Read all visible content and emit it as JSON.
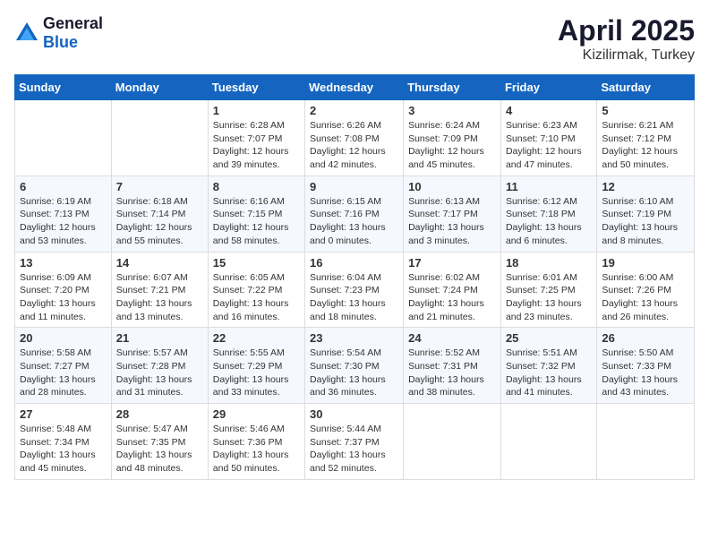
{
  "header": {
    "logo_general": "General",
    "logo_blue": "Blue",
    "month_title": "April 2025",
    "location": "Kizilirmak, Turkey"
  },
  "weekdays": [
    "Sunday",
    "Monday",
    "Tuesday",
    "Wednesday",
    "Thursday",
    "Friday",
    "Saturday"
  ],
  "weeks": [
    [
      {
        "day": "",
        "detail": ""
      },
      {
        "day": "",
        "detail": ""
      },
      {
        "day": "1",
        "detail": "Sunrise: 6:28 AM\nSunset: 7:07 PM\nDaylight: 12 hours and 39 minutes."
      },
      {
        "day": "2",
        "detail": "Sunrise: 6:26 AM\nSunset: 7:08 PM\nDaylight: 12 hours and 42 minutes."
      },
      {
        "day": "3",
        "detail": "Sunrise: 6:24 AM\nSunset: 7:09 PM\nDaylight: 12 hours and 45 minutes."
      },
      {
        "day": "4",
        "detail": "Sunrise: 6:23 AM\nSunset: 7:10 PM\nDaylight: 12 hours and 47 minutes."
      },
      {
        "day": "5",
        "detail": "Sunrise: 6:21 AM\nSunset: 7:12 PM\nDaylight: 12 hours and 50 minutes."
      }
    ],
    [
      {
        "day": "6",
        "detail": "Sunrise: 6:19 AM\nSunset: 7:13 PM\nDaylight: 12 hours and 53 minutes."
      },
      {
        "day": "7",
        "detail": "Sunrise: 6:18 AM\nSunset: 7:14 PM\nDaylight: 12 hours and 55 minutes."
      },
      {
        "day": "8",
        "detail": "Sunrise: 6:16 AM\nSunset: 7:15 PM\nDaylight: 12 hours and 58 minutes."
      },
      {
        "day": "9",
        "detail": "Sunrise: 6:15 AM\nSunset: 7:16 PM\nDaylight: 13 hours and 0 minutes."
      },
      {
        "day": "10",
        "detail": "Sunrise: 6:13 AM\nSunset: 7:17 PM\nDaylight: 13 hours and 3 minutes."
      },
      {
        "day": "11",
        "detail": "Sunrise: 6:12 AM\nSunset: 7:18 PM\nDaylight: 13 hours and 6 minutes."
      },
      {
        "day": "12",
        "detail": "Sunrise: 6:10 AM\nSunset: 7:19 PM\nDaylight: 13 hours and 8 minutes."
      }
    ],
    [
      {
        "day": "13",
        "detail": "Sunrise: 6:09 AM\nSunset: 7:20 PM\nDaylight: 13 hours and 11 minutes."
      },
      {
        "day": "14",
        "detail": "Sunrise: 6:07 AM\nSunset: 7:21 PM\nDaylight: 13 hours and 13 minutes."
      },
      {
        "day": "15",
        "detail": "Sunrise: 6:05 AM\nSunset: 7:22 PM\nDaylight: 13 hours and 16 minutes."
      },
      {
        "day": "16",
        "detail": "Sunrise: 6:04 AM\nSunset: 7:23 PM\nDaylight: 13 hours and 18 minutes."
      },
      {
        "day": "17",
        "detail": "Sunrise: 6:02 AM\nSunset: 7:24 PM\nDaylight: 13 hours and 21 minutes."
      },
      {
        "day": "18",
        "detail": "Sunrise: 6:01 AM\nSunset: 7:25 PM\nDaylight: 13 hours and 23 minutes."
      },
      {
        "day": "19",
        "detail": "Sunrise: 6:00 AM\nSunset: 7:26 PM\nDaylight: 13 hours and 26 minutes."
      }
    ],
    [
      {
        "day": "20",
        "detail": "Sunrise: 5:58 AM\nSunset: 7:27 PM\nDaylight: 13 hours and 28 minutes."
      },
      {
        "day": "21",
        "detail": "Sunrise: 5:57 AM\nSunset: 7:28 PM\nDaylight: 13 hours and 31 minutes."
      },
      {
        "day": "22",
        "detail": "Sunrise: 5:55 AM\nSunset: 7:29 PM\nDaylight: 13 hours and 33 minutes."
      },
      {
        "day": "23",
        "detail": "Sunrise: 5:54 AM\nSunset: 7:30 PM\nDaylight: 13 hours and 36 minutes."
      },
      {
        "day": "24",
        "detail": "Sunrise: 5:52 AM\nSunset: 7:31 PM\nDaylight: 13 hours and 38 minutes."
      },
      {
        "day": "25",
        "detail": "Sunrise: 5:51 AM\nSunset: 7:32 PM\nDaylight: 13 hours and 41 minutes."
      },
      {
        "day": "26",
        "detail": "Sunrise: 5:50 AM\nSunset: 7:33 PM\nDaylight: 13 hours and 43 minutes."
      }
    ],
    [
      {
        "day": "27",
        "detail": "Sunrise: 5:48 AM\nSunset: 7:34 PM\nDaylight: 13 hours and 45 minutes."
      },
      {
        "day": "28",
        "detail": "Sunrise: 5:47 AM\nSunset: 7:35 PM\nDaylight: 13 hours and 48 minutes."
      },
      {
        "day": "29",
        "detail": "Sunrise: 5:46 AM\nSunset: 7:36 PM\nDaylight: 13 hours and 50 minutes."
      },
      {
        "day": "30",
        "detail": "Sunrise: 5:44 AM\nSunset: 7:37 PM\nDaylight: 13 hours and 52 minutes."
      },
      {
        "day": "",
        "detail": ""
      },
      {
        "day": "",
        "detail": ""
      },
      {
        "day": "",
        "detail": ""
      }
    ]
  ]
}
